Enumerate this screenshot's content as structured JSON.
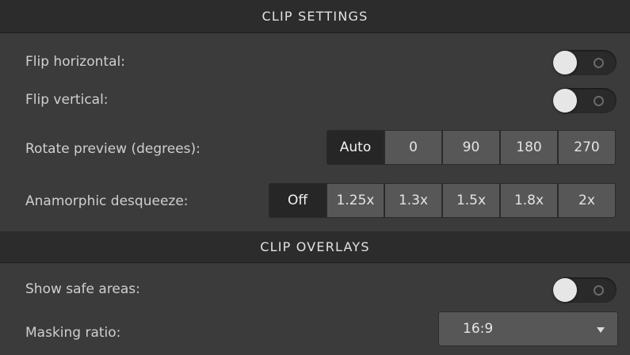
{
  "clip_settings": {
    "title": "CLIP SETTINGS",
    "flip_horizontal": {
      "label": "Flip horizontal:",
      "enabled": false
    },
    "flip_vertical": {
      "label": "Flip vertical:",
      "enabled": false
    },
    "rotate_preview": {
      "label": "Rotate preview (degrees):",
      "options": [
        "Auto",
        "0",
        "90",
        "180",
        "270"
      ],
      "selected": "Auto"
    },
    "anamorphic_desqueeze": {
      "label": "Anamorphic desqueeze:",
      "options": [
        "Off",
        "1.25x",
        "1.3x",
        "1.5x",
        "1.8x",
        "2x"
      ],
      "selected": "Off"
    }
  },
  "clip_overlays": {
    "title": "CLIP OVERLAYS",
    "show_safe_areas": {
      "label": "Show safe areas:",
      "enabled": false
    },
    "masking_ratio": {
      "label": "Masking ratio:",
      "value": "16:9"
    }
  },
  "colors": {
    "panel_bg": "#3b3b3b",
    "header_bg": "#2c2c2c",
    "segment_bg": "#575757",
    "segment_selected_bg": "#262626"
  }
}
